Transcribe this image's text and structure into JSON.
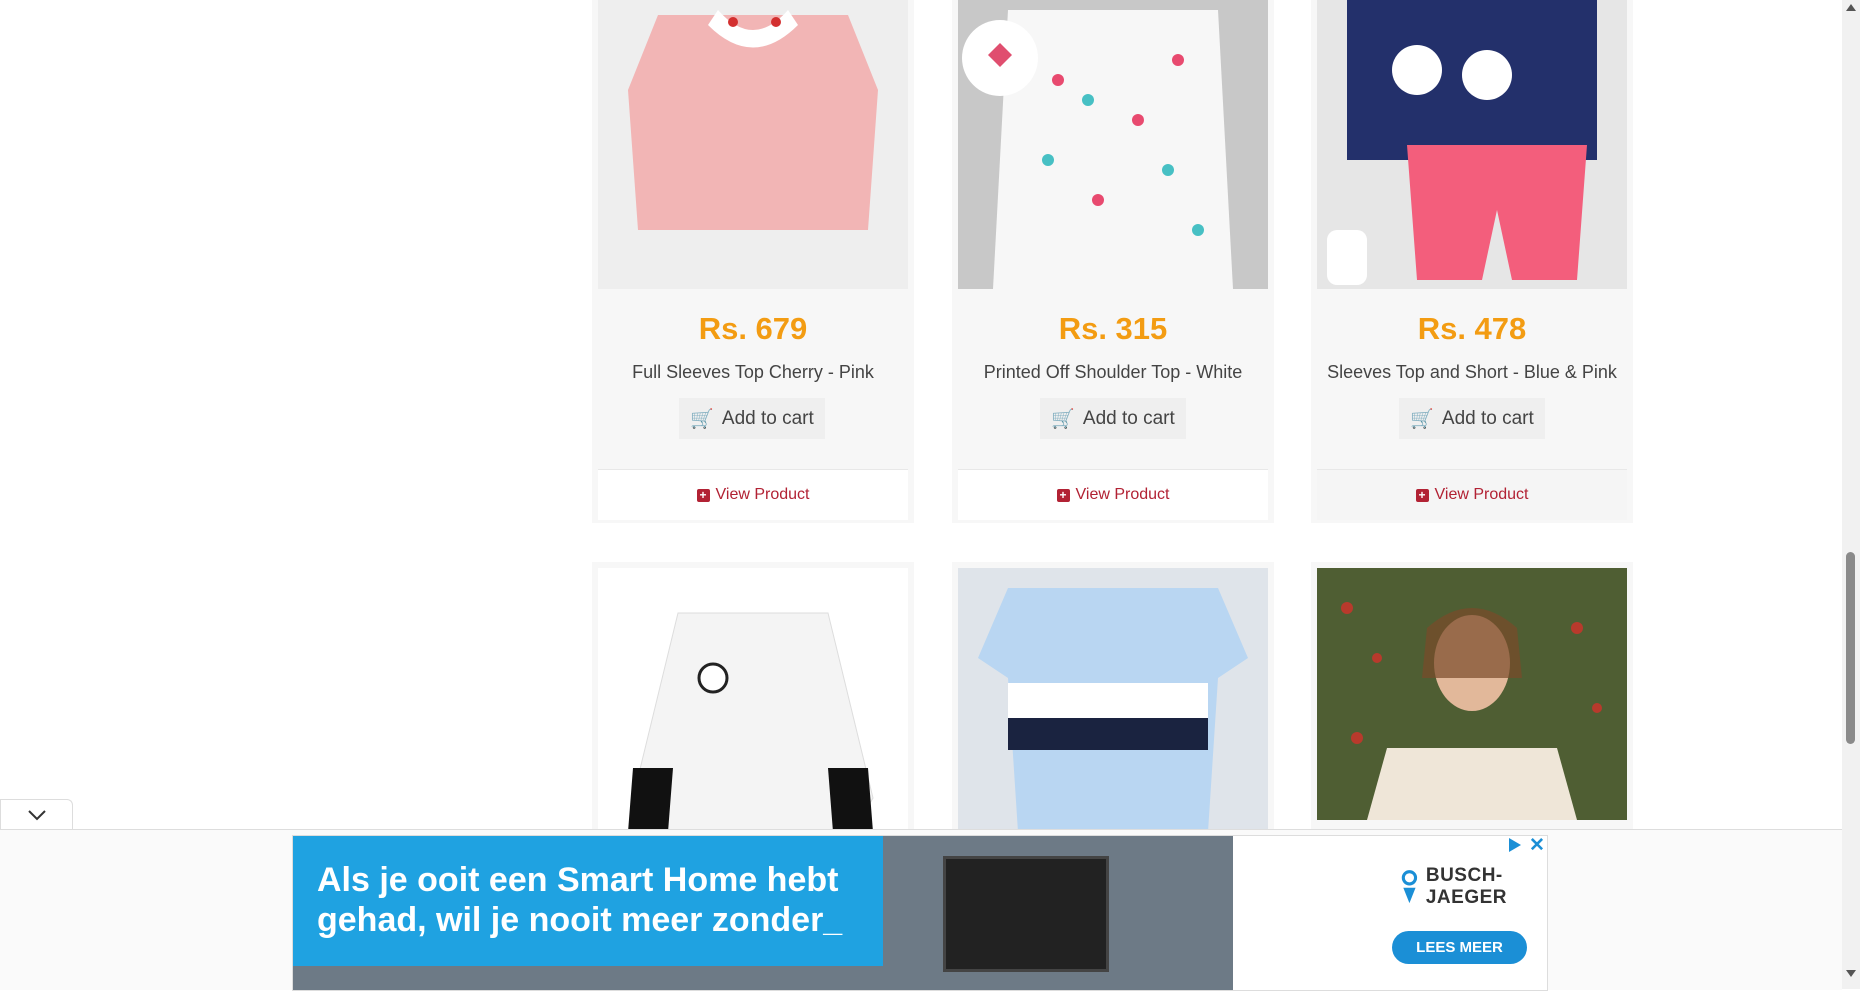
{
  "products_row1": [
    {
      "price": "Rs. 679",
      "name": "Full Sleeves Top Cherry - Pink"
    },
    {
      "price": "Rs. 315",
      "name": "Printed Off Shoulder Top - White"
    },
    {
      "price": "Rs. 478",
      "name": "Sleeves Top and Short - Blue & Pink"
    }
  ],
  "buttons": {
    "add_to_cart": "Add to cart",
    "view_product": "View Product"
  },
  "ad": {
    "headline": "Als je ooit een Smart Home hebt\ngehad, wil je nooit meer zonder_",
    "brand": "BUSCH-JAEGER",
    "cta": "LEES MEER"
  },
  "colors": {
    "price": "#f39c12",
    "view_link": "#b22234",
    "ad_blue": "#1fa2e1"
  },
  "icons": [
    "cart-icon",
    "plus-square-icon",
    "chevron-down-icon",
    "adchoices-icon",
    "close-icon"
  ]
}
